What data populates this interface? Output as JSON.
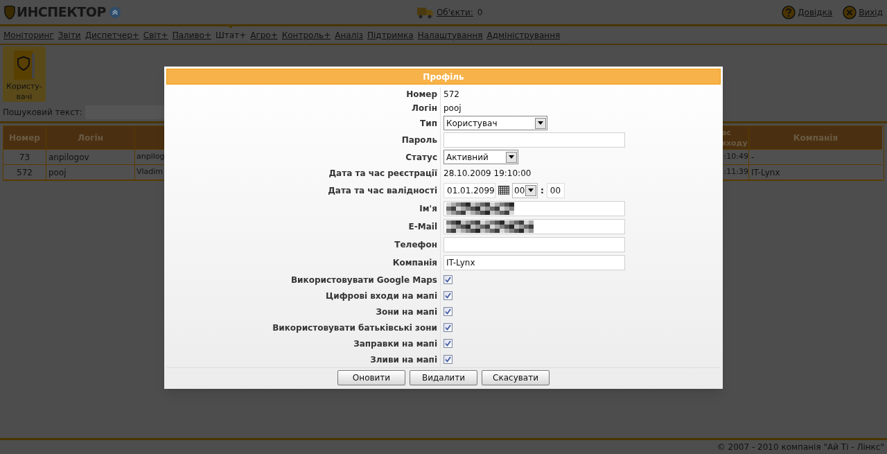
{
  "header": {
    "logo": "ИНСПЕКТОР",
    "objects_label": "Об'єкти:",
    "objects_count": "0",
    "help": "Довідка",
    "exit": "Вихід"
  },
  "nav": [
    {
      "label": "Моніторинг",
      "selected": false
    },
    {
      "label": "Звіти",
      "selected": false
    },
    {
      "label": "Диспетчер+",
      "selected": false
    },
    {
      "label": "Світ+",
      "selected": false
    },
    {
      "label": "Паливо+",
      "selected": false
    },
    {
      "label": "Штат+",
      "selected": true
    },
    {
      "label": "Агро+",
      "selected": false
    },
    {
      "label": "Контроль+",
      "selected": false
    },
    {
      "label": "Аналіз",
      "selected": false
    },
    {
      "label": "Підтримка",
      "selected": false
    },
    {
      "label": "Налаштування",
      "selected": false
    },
    {
      "label": "Адміністрування",
      "selected": false
    }
  ],
  "toolbar": [
    {
      "label": "Користу-вачі",
      "selected": true
    }
  ],
  "search": {
    "label": "Пошуковий текст:"
  },
  "table": {
    "columns": [
      "Номер",
      "Логін",
      "ас входу",
      "Компанія"
    ],
    "rows": [
      {
        "number": "73",
        "login": "anpilogov",
        "column_3": "anpilog",
        "last_login": ":10:49",
        "company": "-"
      },
      {
        "number": "572",
        "login": "pooj",
        "column_3": "Vladim",
        "last_login": ":11:39",
        "company": "IT-Lynx"
      }
    ]
  },
  "dialog": {
    "title": "Профіль",
    "fields": [
      {
        "kind": "text",
        "label": "Номер",
        "value": "572"
      },
      {
        "kind": "text",
        "label": "Логін",
        "value": "pooj"
      },
      {
        "kind": "select",
        "label": "Тип",
        "value": "Користувач"
      },
      {
        "kind": "input",
        "label": "Пароль"
      },
      {
        "kind": "select",
        "label": "Статус",
        "value": "Активний"
      },
      {
        "kind": "text",
        "label": "Дата та час реєстрації",
        "value": "28.10.2009 19:10:00"
      },
      {
        "kind": "datetime",
        "label": "Дата та час валідності",
        "date": "01.01.2099",
        "hour": "00",
        "separator": ":",
        "minute": "00"
      },
      {
        "kind": "input",
        "label": "Ім'я",
        "redacted": true
      },
      {
        "kind": "input",
        "label": "E-Mail",
        "redacted": true
      },
      {
        "kind": "input",
        "label": "Телефон"
      },
      {
        "kind": "input",
        "label": "Компанія",
        "value": "IT-Lynx"
      },
      {
        "kind": "checkbox",
        "label": "Використовувати Google Maps",
        "checked": true
      },
      {
        "kind": "checkbox",
        "label": "Цифрові входи на мапі",
        "checked": true
      },
      {
        "kind": "checkbox",
        "label": "Зони на мапі",
        "checked": true
      },
      {
        "kind": "checkbox",
        "label": "Використовувати батьківські зони",
        "checked": true
      },
      {
        "kind": "checkbox",
        "label": "Заправки на мапі",
        "checked": true
      },
      {
        "kind": "checkbox",
        "label": "Зливи на мапі",
        "checked": true
      }
    ],
    "buttons": [
      "Оновити",
      "Видалити",
      "Скасувати"
    ]
  },
  "footer": "© 2007 - 2010 компанія \"Ай Ті - Лінкс\""
}
